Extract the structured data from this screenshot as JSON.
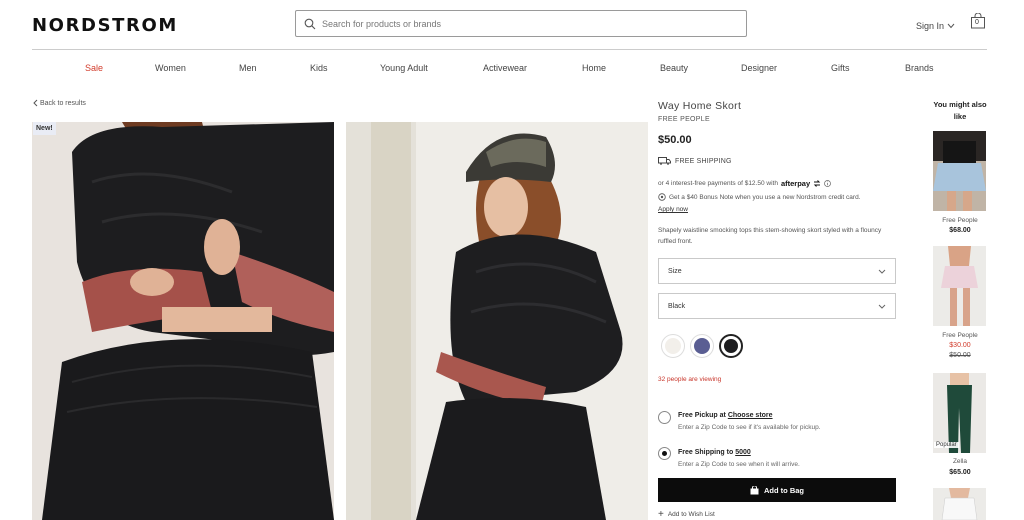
{
  "header": {
    "logo": "NORDSTROM",
    "search_placeholder": "Search for products or brands",
    "sign_in": "Sign In",
    "bag_count": "0"
  },
  "nav": [
    "Sale",
    "Women",
    "Men",
    "Kids",
    "Young Adult",
    "Activewear",
    "Home",
    "Beauty",
    "Designer",
    "Gifts",
    "Brands"
  ],
  "back_link": "Back to results",
  "badge": "New!",
  "product": {
    "title": "Way Home Skort",
    "brand": "FREE PEOPLE",
    "price": "$50.00",
    "shipping": "FREE SHIPPING",
    "afterpay_text": "or 4 interest-free payments of $12.50 with",
    "afterpay_logo": "afterpay",
    "bonus_text": "Get a $40 Bonus Note when you use a new Nordstrom credit card.",
    "apply_now": "Apply now",
    "description": "Shapely waistline smocking tops this stem-showing skort styled with a flouncy ruffled front.",
    "size_label": "Size",
    "color_label": "Black",
    "swatches": [
      "#f2efea",
      "#5a5e93",
      "#1e1e20"
    ],
    "viewing": "32 people are viewing",
    "pickup_title": "Free Pickup at",
    "pickup_link": "Choose store",
    "pickup_sub": "Enter a Zip Code to see if it's available for pickup.",
    "ship_title": "Free Shipping to",
    "ship_link": "5000",
    "ship_sub": "Enter a Zip Code to see when it will arrive.",
    "add_to_bag": "Add to Bag",
    "wishlist": "Add to Wish List"
  },
  "recommendations": {
    "heading": "You might also like",
    "items": [
      {
        "brand": "Free People",
        "price": "$68.00"
      },
      {
        "brand": "Free People",
        "sale_price": "$30.00",
        "orig_price": "$50.00"
      },
      {
        "badge": "Popular",
        "brand": "Zella",
        "price": "$65.00"
      }
    ]
  },
  "colors": {
    "sale": "#d23c2c",
    "button": "#0c0c0c"
  }
}
